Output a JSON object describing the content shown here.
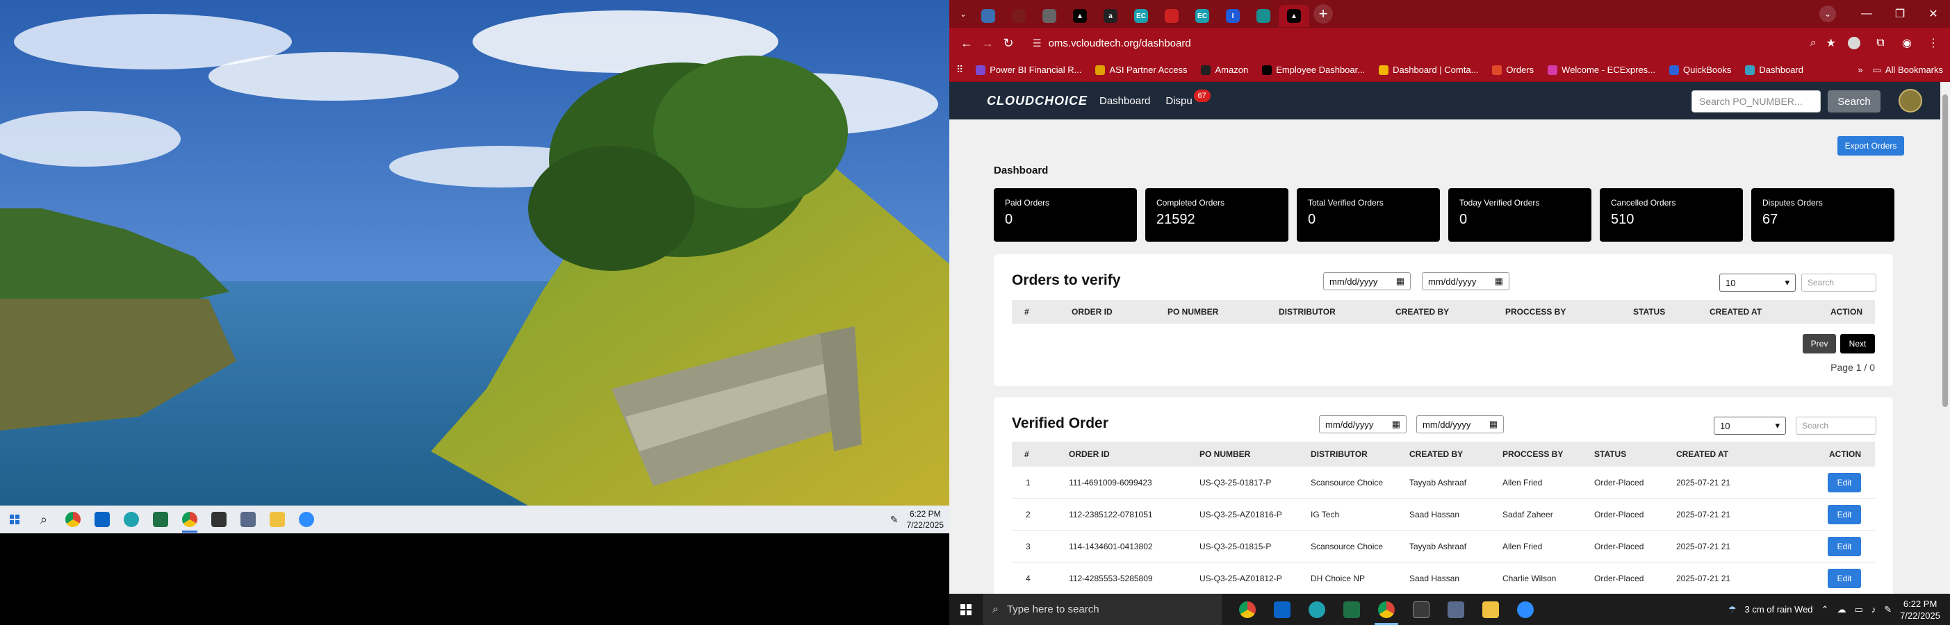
{
  "left_taskbar": {
    "apps": [
      "windows-start",
      "search",
      "chrome",
      "outlook",
      "edge",
      "excel",
      "chrome-active",
      "sticky-notes",
      "calculator",
      "file-explorer",
      "zoom"
    ],
    "time": "6:22 PM",
    "date": "7/22/2025"
  },
  "browser": {
    "tabs": [
      {
        "icon": "cloud-icon",
        "color": "#3a6fb0"
      },
      {
        "icon": "spider-icon",
        "color": "#7a1a1a"
      },
      {
        "icon": "gear-icon",
        "color": "#666666"
      },
      {
        "icon": "triangle-icon",
        "color": "#000000"
      },
      {
        "icon": "amazon-icon",
        "color": "#222222"
      },
      {
        "icon": "ec-icon",
        "color": "#1a9fb0",
        "text": "EC"
      },
      {
        "icon": "red-bar-icon",
        "color": "#cc2222"
      },
      {
        "icon": "ec-icon",
        "color": "#1a9fb0",
        "text": "EC"
      },
      {
        "icon": "info-icon",
        "color": "#1f5bd6",
        "text": "I"
      },
      {
        "icon": "grid-icon",
        "color": "#1a8f8f"
      },
      {
        "icon": "triangle-icon",
        "color": "#000000",
        "active": true
      }
    ],
    "url": "oms.vcloudtech.org/dashboard",
    "bookmarks": [
      {
        "label": "Power BI Financial R...",
        "color": "#7b4bd1"
      },
      {
        "label": "ASI Partner Access",
        "color": "#e0a000"
      },
      {
        "label": "Amazon",
        "color": "#222222"
      },
      {
        "label": "Employee Dashboar...",
        "color": "#000000"
      },
      {
        "label": "Dashboard | Comta...",
        "color": "#f2b400"
      },
      {
        "label": "Orders",
        "color": "#e04a2b"
      },
      {
        "label": "Welcome - ECExpres...",
        "color": "#d43aa8"
      },
      {
        "label": "QuickBooks",
        "color": "#2b62d6"
      },
      {
        "label": "Dashboard",
        "color": "#3aa0c0"
      }
    ],
    "all_bookmarks": "All Bookmarks"
  },
  "app": {
    "brand": "CLOUDCHOICE",
    "nav": {
      "dashboard": "Dashboard",
      "disputes": "Dispu",
      "disputes_badge": "67"
    },
    "search_placeholder": "Search PO_NUMBER...",
    "search_button": "Search",
    "export_button": "Export Orders",
    "page_title": "Dashboard",
    "cards": [
      {
        "label": "Paid Orders",
        "value": "0"
      },
      {
        "label": "Completed Orders",
        "value": "21592"
      },
      {
        "label": "Total Verified Orders",
        "value": "0"
      },
      {
        "label": "Today Verified Orders",
        "value": "0"
      },
      {
        "label": "Cancelled Orders",
        "value": "510"
      },
      {
        "label": "Disputes Orders",
        "value": "67"
      }
    ],
    "date_placeholder": "mm/dd/yyyy",
    "per_page": "10",
    "search_small": "Search",
    "orders_to_verify": {
      "title": "Orders to verify",
      "columns": [
        "#",
        "ORDER ID",
        "PO NUMBER",
        "DISTRIBUTOR",
        "CREATED BY",
        "PROCCESS BY",
        "STATUS",
        "CREATED AT",
        "ACTION"
      ],
      "prev": "Prev",
      "next": "Next",
      "page_text": "Page 1 / 0"
    },
    "verified_order": {
      "title": "Verified Order",
      "columns": [
        "#",
        "ORDER ID",
        "PO NUMBER",
        "DISTRIBUTOR",
        "CREATED BY",
        "PROCCESS BY",
        "STATUS",
        "CREATED AT",
        "ACTION"
      ],
      "rows": [
        {
          "n": "1",
          "order_id": "111-4691009-6099423",
          "po": "US-Q3-25-01817-P",
          "distributor": "Scansource Choice",
          "created_by": "Tayyab Ashraaf",
          "process_by": "Allen Fried",
          "status": "Order-Placed",
          "created_at": "2025-07-21 21",
          "action": "Edit"
        },
        {
          "n": "2",
          "order_id": "112-2385122-0781051",
          "po": "US-Q3-25-AZ01816-P",
          "distributor": "IG Tech",
          "created_by": "Saad Hassan",
          "process_by": "Sadaf Zaheer",
          "status": "Order-Placed",
          "created_at": "2025-07-21 21",
          "action": "Edit"
        },
        {
          "n": "3",
          "order_id": "114-1434601-0413802",
          "po": "US-Q3-25-01815-P",
          "distributor": "Scansource Choice",
          "created_by": "Tayyab Ashraaf",
          "process_by": "Allen Fried",
          "status": "Order-Placed",
          "created_at": "2025-07-21 21",
          "action": "Edit"
        },
        {
          "n": "4",
          "order_id": "112-4285553-5285809",
          "po": "US-Q3-25-AZ01812-P",
          "distributor": "DH Choice NP",
          "created_by": "Saad Hassan",
          "process_by": "Charlie Wilson",
          "status": "Order-Placed",
          "created_at": "2025-07-21 21",
          "action": "Edit"
        }
      ]
    }
  },
  "right_taskbar": {
    "search_placeholder": "Type here to search",
    "weather": "3 cm of rain Wed",
    "time": "6:22 PM",
    "date": "7/22/2025"
  }
}
